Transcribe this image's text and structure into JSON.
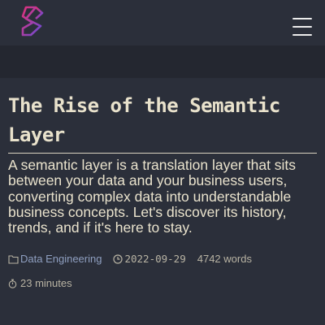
{
  "header": {
    "logo_icon": "brand-logo",
    "menu_icon": "hamburger-menu-icon"
  },
  "article": {
    "title": "The Rise of the Semantic Layer",
    "summary": "A semantic layer is a translation layer that sits between your data and your business users, converting complex data into understandable business concepts. Let's discover its history, trends, and if it's here to stay.",
    "category": "Data Engineering",
    "date": "2022-09-29",
    "word_count": "4742 words",
    "read_time": "23 minutes"
  },
  "colors": {
    "background": "#2b2f3a",
    "text": "#e9e2cc",
    "link": "#8f9fc0",
    "logo_gradient_start": "#e0317a",
    "logo_gradient_end": "#6a4cd6"
  }
}
